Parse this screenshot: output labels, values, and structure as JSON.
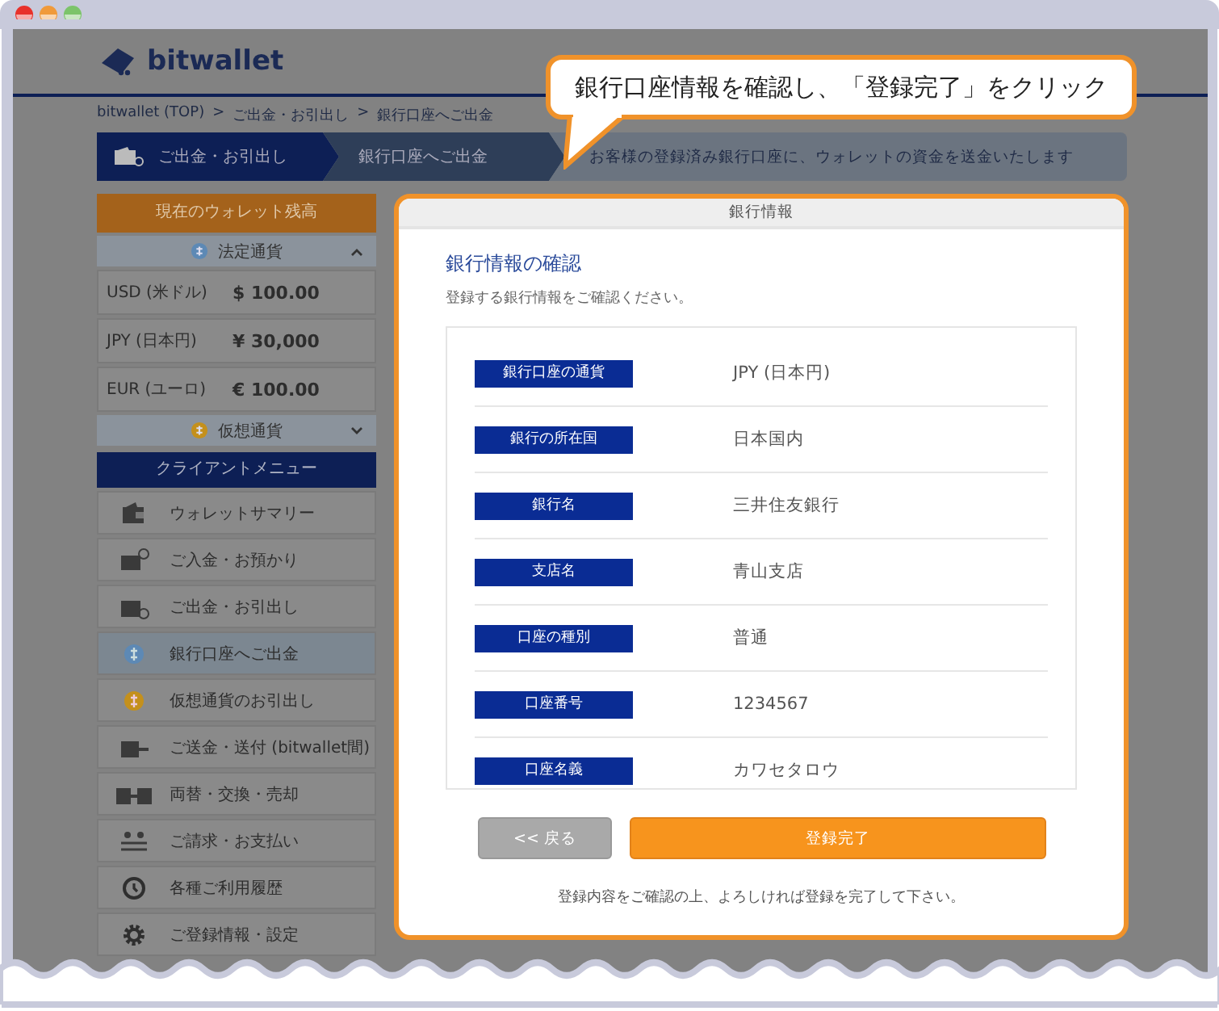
{
  "header": {
    "logo_text": "bitwallet"
  },
  "breadcrumb": {
    "separator": ">",
    "items": [
      "bitwallet (TOP)",
      "ご出金・お引出し",
      "銀行口座へご出金"
    ]
  },
  "steps": [
    {
      "label": "ご出金・お引出し",
      "kind": "section"
    },
    {
      "label": "銀行口座へご出金",
      "kind": "page"
    },
    {
      "label": "お客様の登録済み銀行口座に、ウォレットの資金を送金いたします",
      "kind": "description"
    }
  ],
  "wallet": {
    "title": "現在のウォレット残高",
    "groups": [
      {
        "name": "法定通貨",
        "kind": "fiat",
        "expanded": true,
        "balances": [
          {
            "currency": "USD (米ドル)",
            "amount": "$ 100.00"
          },
          {
            "currency": "JPY (日本円)",
            "amount": "¥ 30,000"
          },
          {
            "currency": "EUR (ユーロ)",
            "amount": "€ 100.00"
          }
        ]
      },
      {
        "name": "仮想通貨",
        "kind": "crypto",
        "expanded": false
      }
    ]
  },
  "client_menu": {
    "title": "クライアントメニュー",
    "items": [
      {
        "label": "ウォレットサマリー",
        "kind": "wallet",
        "selected": false
      },
      {
        "label": "ご入金・お預かり",
        "kind": "deposit",
        "selected": false
      },
      {
        "label": "ご出金・お引出し",
        "kind": "withdraw",
        "selected": false
      },
      {
        "label": "銀行口座へご出金",
        "kind": "fiat-coin",
        "selected": true
      },
      {
        "label": "仮想通貨のお引出し",
        "kind": "crypto-coin",
        "selected": false
      },
      {
        "label": "ご送金・送付 (bitwallet間)",
        "kind": "send",
        "selected": false
      },
      {
        "label": "両替・交換・売却",
        "kind": "exchange",
        "selected": false
      },
      {
        "label": "ご請求・お支払い",
        "kind": "billing",
        "selected": false
      },
      {
        "label": "各種ご利用履歴",
        "kind": "history",
        "selected": false
      },
      {
        "label": "ご登録情報・設定",
        "kind": "settings",
        "selected": false
      }
    ]
  },
  "callout": {
    "text": "銀行口座情報を確認し、「登録完了」をクリック"
  },
  "panel": {
    "header": "銀行情報",
    "title": "銀行情報の確認",
    "subtitle": "登録する銀行情報をご確認ください。",
    "fields": [
      {
        "label": "銀行口座の通貨",
        "value": "JPY (日本円)"
      },
      {
        "label": "銀行の所在国",
        "value": "日本国内"
      },
      {
        "label": "銀行名",
        "value": "三井住友銀行"
      },
      {
        "label": "支店名",
        "value": "青山支店"
      },
      {
        "label": "口座の種別",
        "value": "普通"
      },
      {
        "label": "口座番号",
        "value": "1234567"
      },
      {
        "label": "口座名義",
        "value": "カワセタロウ"
      }
    ],
    "buttons": [
      {
        "label": "<< 戻る",
        "kind": "back"
      },
      {
        "label": "登録完了",
        "kind": "primary"
      }
    ],
    "note": "登録内容をご確認の上、よろしければ登録を完了して下さい。"
  }
}
